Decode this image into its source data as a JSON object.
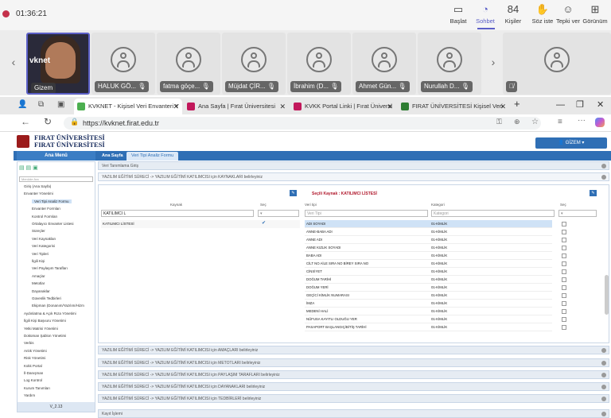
{
  "teams": {
    "time": "01:36:21",
    "buttons": [
      {
        "label": "Başlat",
        "icon": "share-screen-icon",
        "glyph": "▭"
      },
      {
        "label": "Sohbet",
        "icon": "chat-icon",
        "glyph": "◔"
      },
      {
        "label": "Kişiler",
        "icon": "people-icon",
        "glyph": "84"
      },
      {
        "label": "Söz iste",
        "icon": "raise-hand-icon",
        "glyph": "✋"
      },
      {
        "label": "Tepki ver",
        "icon": "react-icon",
        "glyph": "☺"
      },
      {
        "label": "Görünüm",
        "icon": "view-icon",
        "glyph": "⊞"
      }
    ],
    "participants": [
      "Gizem",
      "HALUK GÖ...",
      "fatma göçe...",
      "Müjdat ÇİR...",
      "İbrahim (D...",
      "Ahmet Gün...",
      "Nurullah D..."
    ],
    "tile_logo": "vknet"
  },
  "browser": {
    "tabs": [
      {
        "label": "KVKNET - Kişisel Veri Envanteri Y",
        "color": "#4caf50"
      },
      {
        "label": "Ana Sayfa | Fırat Üniversitesi",
        "color": "#c2185b"
      },
      {
        "label": "KVKK Portal Linki | Fırat Üniversi",
        "color": "#c2185b"
      },
      {
        "label": "FIRAT ÜNİVERSİTESİ Kişisel Veri",
        "color": "#2e7d32"
      }
    ],
    "url": "https://kvknet.firat.edu.tr"
  },
  "app": {
    "university": "FIRAT ÜNİVERSİTESİ",
    "user_button": "GİZEM",
    "main_menu": "Ana Menü",
    "tab_home": "Ana Sayfa",
    "tab_form": "Veri Tipi Analiz Formu",
    "search_placeholder": "Menüde Ara",
    "sidebar_items": [
      "Giriş (Ana Sayfa)",
      "Envanter Yönetimi",
      "Veri Tipi Analiz Formu",
      "Envanter Formları",
      "Kontrol Formları",
      "Ortalayıcı Envanter Listesi",
      "Süreçler",
      "Veri Kaynakları",
      "Veri Kategorisi",
      "Veri Tipleri",
      "İlgili Kişi",
      "Veri Paylaşım Tarafları",
      "Amaçlar",
      "Metotlar",
      "Dayanaklar",
      "Güvenlik Tedbirleri",
      "Ekipman (Donanım/Yazılım/Hizm",
      "Aydınlatma & Açık Rıza Yönetimi",
      "İlgili Kişi Başvuru Yönetimi",
      "Yetki Matrisi Yönetimi",
      "Doküman Şablon Yönetimi",
      "Verbis",
      "Anlık Yönetimi",
      "Risk Yönetimi",
      "Kvkk Portal",
      "İl-Danışman",
      "Log Kontrol",
      "Kurum Tanımları",
      "Yardım"
    ],
    "version": "V_2.13",
    "section_title": "Veri Tanımlama Giriş",
    "subsection": "YAZILIM EĞİTİMİ SÜRECİ -> YAZILIM EĞİTİMİ KATILIMCISI için KAYNAKLARI belirleyiniz",
    "selected_source": "Seçili Kaynak : KATILIMCI LİSTESİ",
    "col_kaynak": "Kaynak",
    "col_sec": "Seç",
    "col_veritipi": "Veri tipi",
    "col_kategori": "Kategori",
    "col_sec2": "Seç",
    "source_filter": "KATILIMCI L",
    "veritipi_placeholder": "Veri Tipi",
    "kategori_placeholder": "Kategori",
    "source_row": "KATILIMCI LİSTESİ",
    "rows": [
      [
        "ADI SOYADI",
        "01-KİMLİK"
      ],
      [
        "ANNE-BABA ADI",
        "01-KİMLİK"
      ],
      [
        "ANNE ADI",
        "01-KİMLİK"
      ],
      [
        "ANNE KIZLIK SOYADI",
        "01-KİMLİK"
      ],
      [
        "BABA ADI",
        "01-KİMLİK"
      ],
      [
        "CİLT NO AİLE SIRA NO BİREY SIRA NO",
        "01-KİMLİK"
      ],
      [
        "CİNSİYET",
        "01-KİMLİK"
      ],
      [
        "DOĞUM TARİHİ",
        "01-KİMLİK"
      ],
      [
        "DOĞUM YERİ",
        "01-KİMLİK"
      ],
      [
        "GEÇİCİ KİMLİK NUMARASI",
        "01-KİMLİK"
      ],
      [
        "İMZA",
        "01-KİMLİK"
      ],
      [
        "MEDENİ HALİ",
        "01-KİMLİK"
      ],
      [
        "NÜFUSA KAYITLI OLDUĞU YER",
        "01-KİMLİK"
      ],
      [
        "PASAPORT BAŞLANGIÇ/BİTİŞ TARİHİ",
        "01-KİMLİK"
      ]
    ],
    "panels": [
      "YAZILIM EĞİTİMİ SÜRECİ -> YAZILIM EĞİTİMİ KATILIMCISI için AMAÇLARI belirleyiniz",
      "YAZILIM EĞİTİMİ SÜRECİ -> YAZILIM EĞİTİMİ KATILIMCISI için METOTLARI belirleyiniz",
      "YAZILIM EĞİTİMİ SÜRECİ -> YAZILIM EĞİTİMİ KATILIMCISI için PAYLAŞIM TARAFLARI belirleyiniz",
      "YAZILIM EĞİTİMİ SÜRECİ -> YAZILIM EĞİTİMİ KATILIMCISI için DAYANAKLARI belirleyiniz",
      "YAZILIM EĞİTİMİ SÜRECİ -> YAZILIM EĞİTİMİ KATILIMCISI için TEDBİRLERİ belirleyiniz",
      "Kayıt İşlemi"
    ]
  }
}
